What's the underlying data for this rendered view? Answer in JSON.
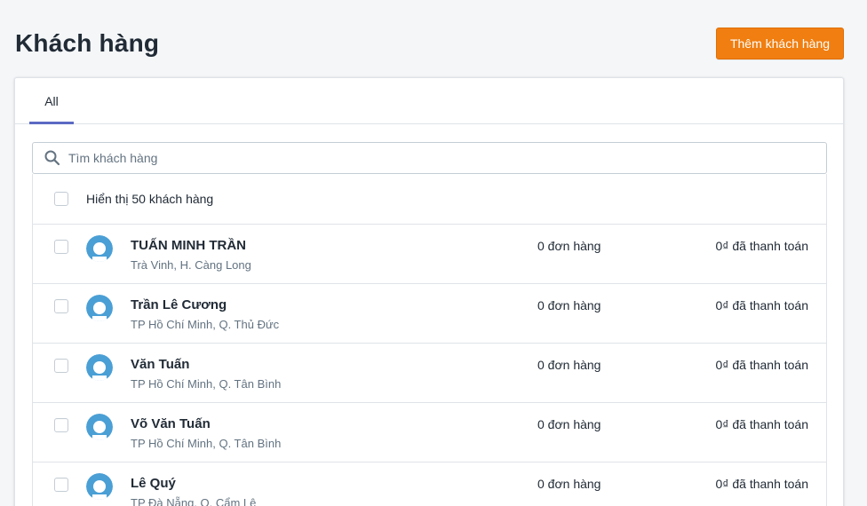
{
  "header": {
    "title": "Khách hàng",
    "add_button_label": "Thêm khách hàng"
  },
  "tabs": [
    {
      "label": "All",
      "active": true
    }
  ],
  "search": {
    "placeholder": "Tìm khách hàng",
    "value": ""
  },
  "list": {
    "header_label": "Hiển thị 50 khách hàng",
    "rows": [
      {
        "name": "TUẤN MINH TRẦN",
        "location": "Trà Vinh, H. Càng Long",
        "orders": "0 đơn hàng",
        "paid": "0₫ đã thanh toán"
      },
      {
        "name": "Trần Lê Cương",
        "location": "TP Hồ Chí Minh, Q. Thủ Đức",
        "orders": "0 đơn hàng",
        "paid": "0₫ đã thanh toán"
      },
      {
        "name": "Văn Tuấn",
        "location": "TP Hồ Chí Minh, Q. Tân Bình",
        "orders": "0 đơn hàng",
        "paid": "0₫ đã thanh toán"
      },
      {
        "name": "Võ Văn Tuấn",
        "location": "TP Hồ Chí Minh, Q. Tân Bình",
        "orders": "0 đơn hàng",
        "paid": "0₫ đã thanh toán"
      },
      {
        "name": "Lê Quý",
        "location": "TP Đà Nẵng, Q. Cẩm Lệ",
        "orders": "0 đơn hàng",
        "paid": "0₫ đã thanh toán"
      }
    ]
  },
  "colors": {
    "accent": "#f07e10",
    "tab_indicator": "#5c6ac4",
    "avatar": "#4a9fd5"
  },
  "icons": {
    "search": "search-icon",
    "avatar": "user-avatar-icon"
  }
}
